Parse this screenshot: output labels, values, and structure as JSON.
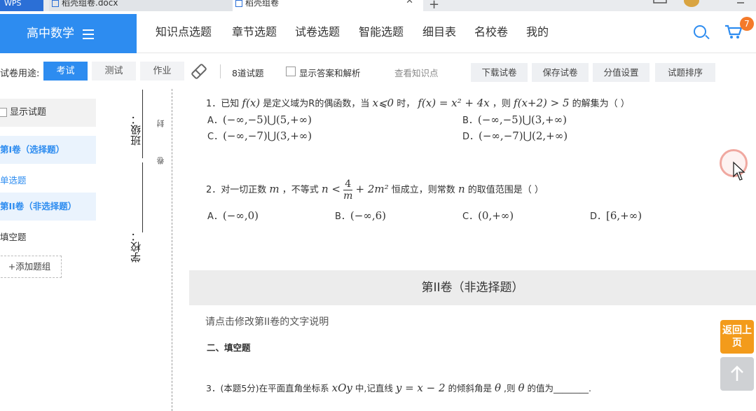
{
  "tabs": {
    "app_label": "WPS",
    "tab1_label": "稻壳组卷.docx",
    "tab2_label": "稻壳组卷",
    "close_glyph": "✕",
    "plus_glyph": "+"
  },
  "nav": {
    "subject": "高中数学",
    "items": [
      "知识点选题",
      "章节选题",
      "试卷选题",
      "智能选题",
      "细目表",
      "名校卷",
      "我的"
    ],
    "cart_count": "7"
  },
  "toolbar": {
    "purpose_label": "试卷用途:",
    "btn_exam": "考试",
    "btn_test": "测试",
    "btn_homework": "作业",
    "question_count": "8道试题",
    "show_answer_label": "显示答案和解析",
    "view_knowledge": "查看知识点",
    "download": "下载试卷",
    "save": "保存试卷",
    "score": "分值设置",
    "sort": "试题排序"
  },
  "sidebar": {
    "show_questions": "显示试题",
    "section1": "第I卷（选择题）",
    "sub1": "单选题",
    "section2": "第II卷（非选择题）",
    "sub2": "填空题",
    "add_group": "+添加题组"
  },
  "binding": {
    "class_label": "班级：",
    "school_label": "学校：",
    "mark_seal": "封",
    "mark_roll": "卷"
  },
  "questions": {
    "q1": {
      "p1": "1．已知",
      "p2": "是定义域为R的偶函数，当",
      "p3": "时，",
      "p4": "，则",
      "p5": "的解集为（   ）",
      "m_fx": "f(x)",
      "m_cond": "x⩽0",
      "m_def": "f(x) = x² + 4x",
      "m_ineq": "f(x+2) > 5",
      "A_label": "A．",
      "A_val": "(−∞,−5)⋃(5,+∞)",
      "B_label": "B．",
      "B_val": "(−∞,−5)⋃(3,+∞)",
      "C_label": "C．",
      "C_val": "(−∞,−7)⋃(3,+∞)",
      "D_label": "D．",
      "D_val": "(−∞,−7)⋃(2,+∞)"
    },
    "q2": {
      "p1": "2．对一切正数",
      "m_m": "m",
      "p2": "，不等式",
      "m_n_lt": "n <",
      "frac_num": "4",
      "frac_den": "m",
      "m_tail": "+ 2m²",
      "p3": "恒成立，则常数",
      "m_n": "n",
      "p4": "的取值范围是（   ）",
      "A_label": "A．",
      "A_val": "(−∞,0)",
      "B_label": "B．",
      "B_val": "(−∞,6)",
      "C_label": "C．",
      "C_val": "(0,+∞)",
      "D_label": "D．",
      "D_val": "[6,+∞)"
    },
    "section2_title": "第II卷（非选择题）",
    "section2_desc": "请点击修改第II卷的文字说明",
    "fill_heading": "二、填空题",
    "q3": {
      "p1": "3．(本题5分)在平面直角坐标系",
      "m_xoy": "xOy",
      "p2": "中,记直线",
      "m_line": "y = x − 2",
      "p3": "的倾斜角是",
      "m_theta": "θ",
      "p4": ",则",
      "m_theta2": "θ",
      "p5": "的值为________."
    }
  },
  "floating": {
    "back_top": "返回上页"
  },
  "colors": {
    "accent": "#2d8cf0",
    "orange": "#f39b1b",
    "badge": "#f47a2a"
  }
}
